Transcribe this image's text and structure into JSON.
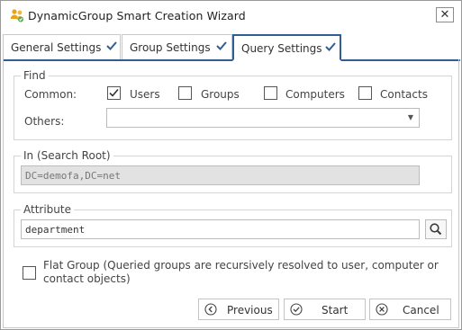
{
  "window": {
    "title": "DynamicGroup Smart Creation Wizard",
    "app_icon": "people-group-icon",
    "close_label": "✕"
  },
  "tabs": [
    {
      "label": "General Settings",
      "done": true,
      "active": false
    },
    {
      "label": "Group Settings",
      "done": true,
      "active": false
    },
    {
      "label": "Query Settings",
      "done": true,
      "active": true
    }
  ],
  "find": {
    "legend": "Find",
    "common_label": "Common:",
    "others_label": "Others:",
    "others_value": "",
    "options": [
      {
        "label": "Users",
        "checked": true
      },
      {
        "label": "Groups",
        "checked": false
      },
      {
        "label": "Computers",
        "checked": false
      },
      {
        "label": "Contacts",
        "checked": false
      }
    ]
  },
  "search_root": {
    "legend": "In (Search Root)",
    "value": "DC=demofa,DC=net",
    "enabled": false
  },
  "attribute": {
    "legend": "Attribute",
    "value": "department"
  },
  "flat_group": {
    "checked": false,
    "text": "Flat Group (Queried groups are recursively resolved to user, computer or contact objects)"
  },
  "buttons": {
    "previous": "Previous",
    "start": "Start",
    "cancel": "Cancel"
  },
  "colors": {
    "accent": "#2f5e96",
    "border": "#c8c8c8",
    "disabled_bg": "#e2e2e2"
  }
}
